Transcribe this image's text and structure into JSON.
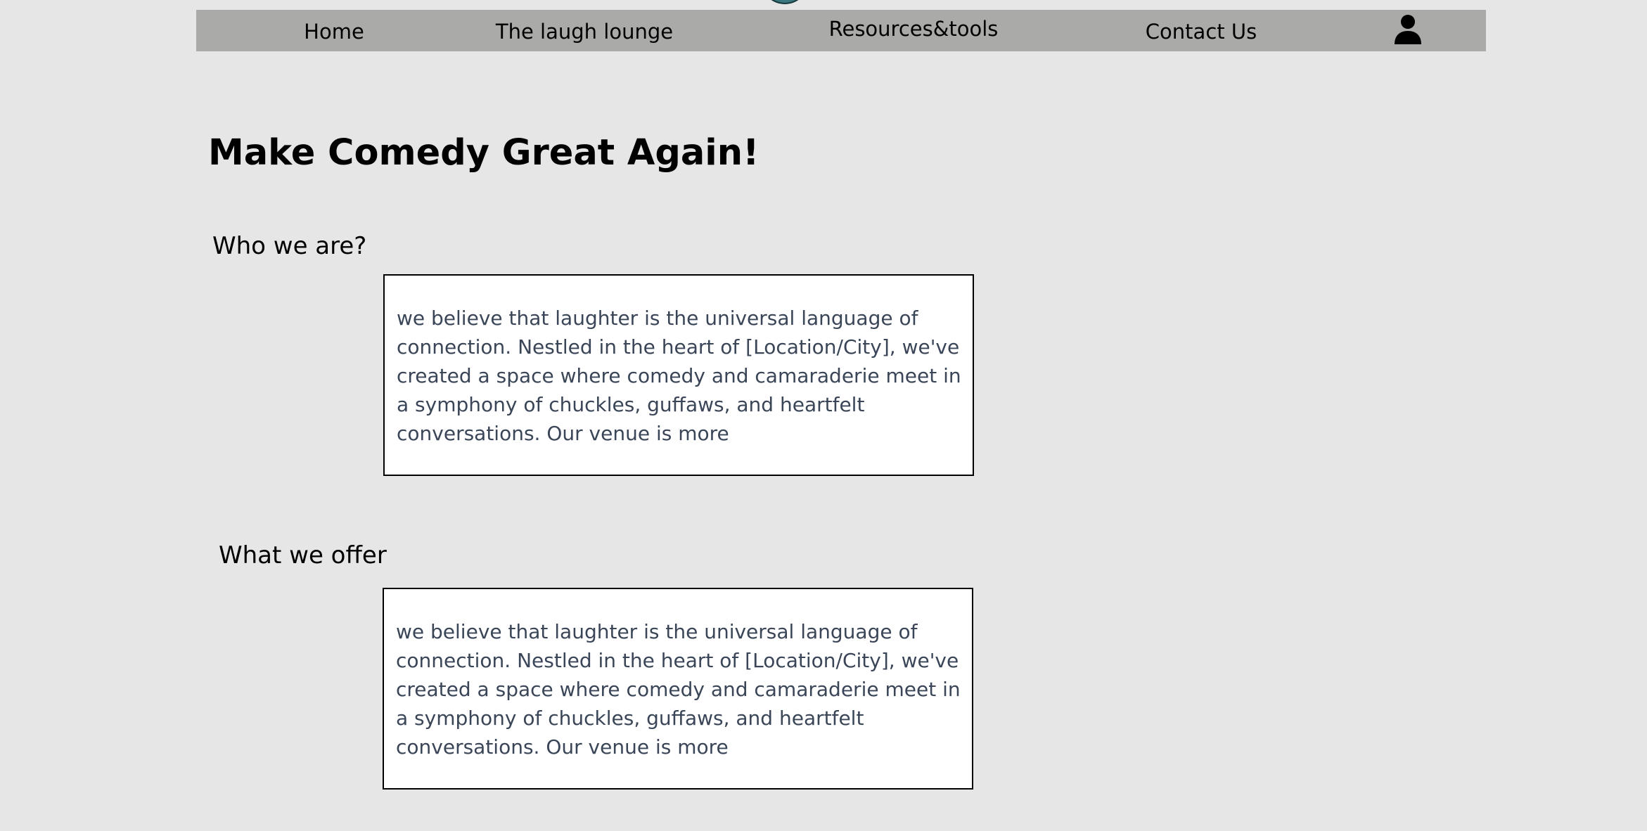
{
  "nav": {
    "items": [
      {
        "label": "Home"
      },
      {
        "label": "The laugh lounge"
      },
      {
        "label": "Resources&tools"
      },
      {
        "label": "Contact Us"
      }
    ],
    "account_icon": "user-icon"
  },
  "page_title": "Make Comedy Great Again!",
  "sections": [
    {
      "heading": "Who we are?",
      "body": "we believe that laughter is the universal language of connection. Nestled in the heart of [Location/City], we've created a space where comedy and camaraderie meet in a symphony of chuckles, guffaws, and heartfelt conversations. Our venue is more"
    },
    {
      "heading": "What we offer",
      "body": "we believe that laughter is the universal language of connection. Nestled in the heart of [Location/City], we've created a space where comedy and camaraderie meet in a symphony of chuckles, guffaws, and heartfelt conversations. Our venue is more"
    }
  ],
  "colors": {
    "page_background": "#e6e6e6",
    "navbar_background": "#aaaaa9",
    "box_background": "#ffffff",
    "box_text": "#3a4658"
  }
}
